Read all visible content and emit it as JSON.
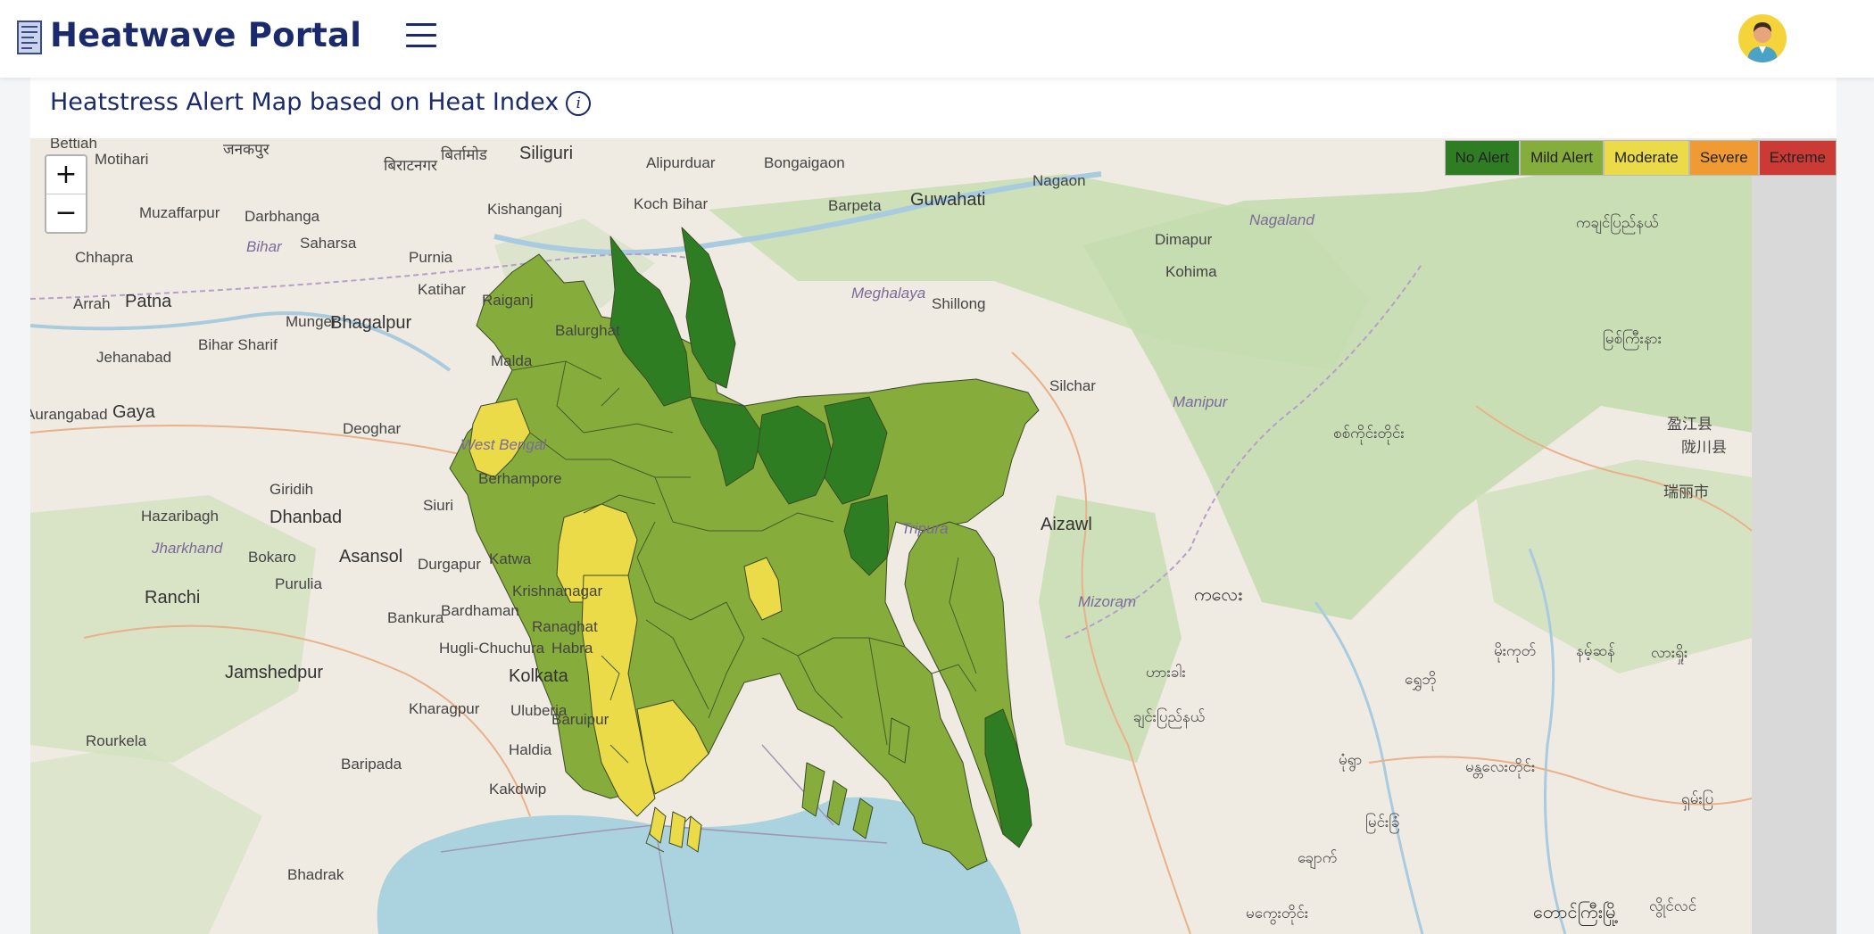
{
  "header": {
    "app_title": "Heatwave Portal",
    "menu_icon": "hamburger-menu-icon",
    "avatar_icon": "user-avatar-icon"
  },
  "card": {
    "title": "Heatstress Alert Map based on Heat Index",
    "info_icon": "i"
  },
  "map": {
    "zoom_in": "+",
    "zoom_out": "−",
    "legend": [
      {
        "label": "No Alert",
        "color": "#2f7d23"
      },
      {
        "label": "Mild Alert",
        "color": "#85ad3b"
      },
      {
        "label": "Moderate",
        "color": "#ebdb48"
      },
      {
        "label": "Severe",
        "color": "#ef9a32"
      },
      {
        "label": "Extreme",
        "color": "#cc3a36"
      }
    ],
    "place_labels": [
      "Bettiah",
      "Motihari",
      "जनकपुर",
      "बिराटनगर",
      "बिर्तामोड",
      "Siliguri",
      "Alipurduar",
      "Bongaigaon",
      "Guwahati",
      "Nagaon",
      "Muzaffarpur",
      "Darbhanga",
      "Kishanganj",
      "Koch Bihar",
      "Barpeta",
      "Nagaland",
      "Saharsa",
      "Bihar",
      "Dimapur",
      "Chhapra",
      "Purnia",
      "Meghalaya",
      "Kohima",
      "Arrah",
      "Patna",
      "Katihar",
      "Raiganj",
      "Shillong",
      "Munger",
      "Bhagalpur",
      "Balurghat",
      "Jehanabad",
      "Bihar Sharif",
      "Malda",
      "Silchar",
      "Manipur",
      "Aurangabad",
      "Gaya",
      "Deoghar",
      "West Bengal",
      "Berhampore",
      "Giridih",
      "Siuri",
      "Hazaribagh",
      "Dhanbad",
      "Jharkhand",
      "Tripura",
      "Aizawl",
      "Bokaro",
      "Asansol",
      "Durgapur",
      "Katwa",
      "Ranchi",
      "Purulia",
      "Krishnanagar",
      "Bankura",
      "Bardhaman",
      "Mizoram",
      "Ranaghat",
      "Hugli-Chuchura",
      "Habra",
      "Jamshedpur",
      "Kolkata",
      "Kharagpur",
      "Uluberia",
      "Baruipur",
      "Rourkela",
      "Haldia",
      "Baripada",
      "Kakdwip",
      "Bhadrak",
      "ကချင်ပြည်နယ်",
      "မြစ်ကြီးနား",
      "盈江县",
      "陇川县",
      "瑞丽市",
      "စစ်ကိုင်းတိုင်း",
      "ကလေး",
      "ဟားခါး",
      "ချင်းပြည်နယ်",
      "မိုးကုတ်",
      "နမ့်ဆန်",
      "လားရှိုး",
      "ရွှေဘို",
      "မုံရွာ",
      "မန္တလေးတိုင်း",
      "ရှမ်းပြ",
      "မြင်းခြံ",
      "ချောက်",
      "မကွေးတိုင်း",
      "တောင်ကြီးမြို့",
      "လွိုင်လင်"
    ]
  }
}
